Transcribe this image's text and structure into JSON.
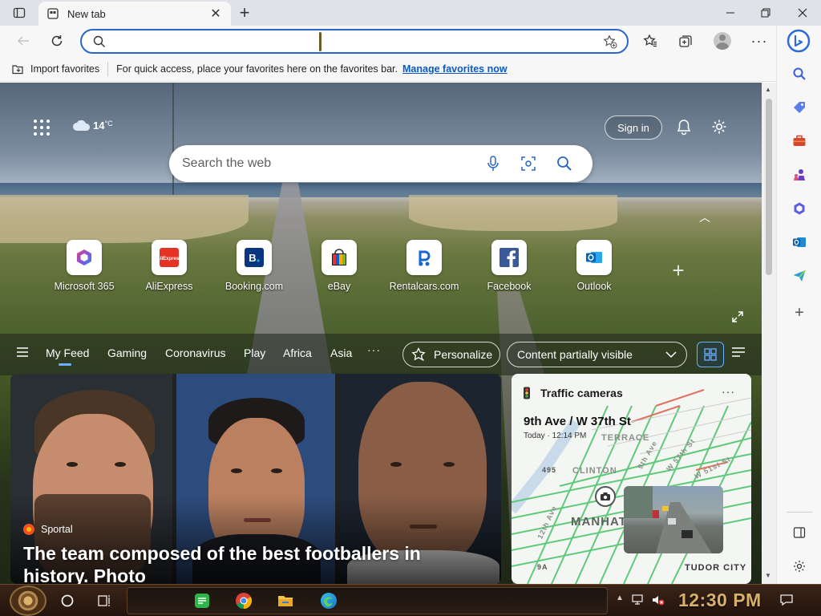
{
  "browser": {
    "tab": {
      "title": "New tab"
    },
    "address_bar": {
      "value": "",
      "placeholder": ""
    },
    "favorites_bar": {
      "import_label": "Import favorites",
      "hint": "For quick access, place your favorites here on the favorites bar.",
      "manage_link": "Manage favorites now"
    }
  },
  "newtab": {
    "weather": {
      "temperature": "14",
      "unit": "°C"
    },
    "sign_in": "Sign in",
    "search": {
      "placeholder": "Search the web"
    },
    "quick_links": [
      {
        "label": "Microsoft 365",
        "icon": "microsoft365-icon"
      },
      {
        "label": "AliExpress",
        "icon": "aliexpress-icon"
      },
      {
        "label": "Booking.com",
        "icon": "booking-icon"
      },
      {
        "label": "eBay",
        "icon": "ebay-icon"
      },
      {
        "label": "Rentalcars.com",
        "icon": "rentalcars-icon"
      },
      {
        "label": "Facebook",
        "icon": "facebook-icon"
      },
      {
        "label": "Outlook",
        "icon": "outlook-icon"
      }
    ],
    "feed_nav": {
      "items": [
        "My Feed",
        "Gaming",
        "Coronavirus",
        "Play",
        "Africa",
        "Asia"
      ],
      "more": "···",
      "personalize": "Personalize",
      "content_visibility": "Content partially visible"
    },
    "main_card": {
      "source": "Sportal",
      "headline": "The team composed of the best footballers in history. Photo"
    },
    "traffic_card": {
      "title": "Traffic cameras",
      "more": "···",
      "location": "9th Ave / W 37th St",
      "time": "Today · 12:14 PM",
      "map_labels": [
        "TERRACE",
        "CLINTON",
        "MANHAT",
        "TUDOR CITY",
        "495",
        "9A",
        "W 57th St",
        "W 51st St",
        "12th Ave",
        "9th Ave"
      ]
    }
  },
  "taskbar": {
    "clock": "12:30 PM"
  },
  "colors": {
    "accent": "#2a66c9",
    "link": "#0a59c6",
    "clock": "#d8b06a"
  }
}
